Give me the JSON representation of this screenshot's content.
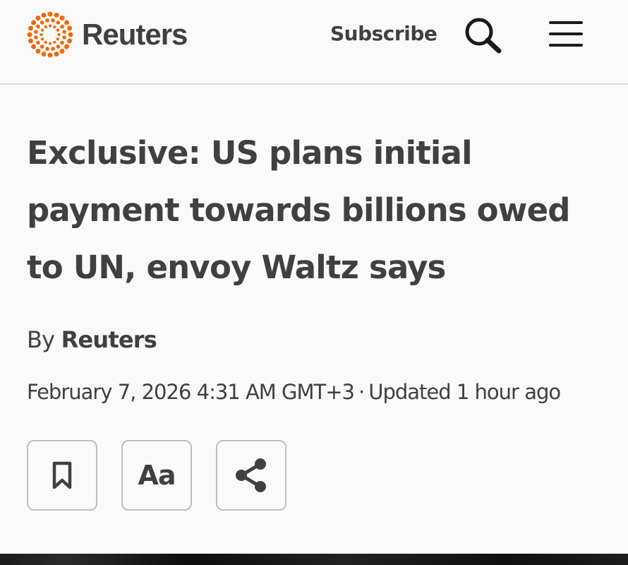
{
  "header": {
    "logo_text": "Reuters",
    "subscribe_label": "Subscribe",
    "search_icon": "search-icon",
    "menu_icon": "hamburger-menu-icon",
    "brand_color": "#fa6400"
  },
  "article": {
    "headline": "Exclusive: US plans initial payment towards billions owed to UN, envoy Waltz says",
    "byline_prefix": "By",
    "author": "Reuters",
    "date": "February 7, 2026 4:31 AM GMT+3",
    "separator": "·",
    "updated": "Updated 1 hour ago"
  },
  "actions": {
    "bookmark_icon": "bookmark-icon",
    "text_size_label": "Aa",
    "share_icon": "share-icon"
  },
  "colors": {
    "text": "#404040",
    "divider": "#d8d8d8",
    "button_border": "#bdbdbd",
    "background": "#fafafa"
  }
}
